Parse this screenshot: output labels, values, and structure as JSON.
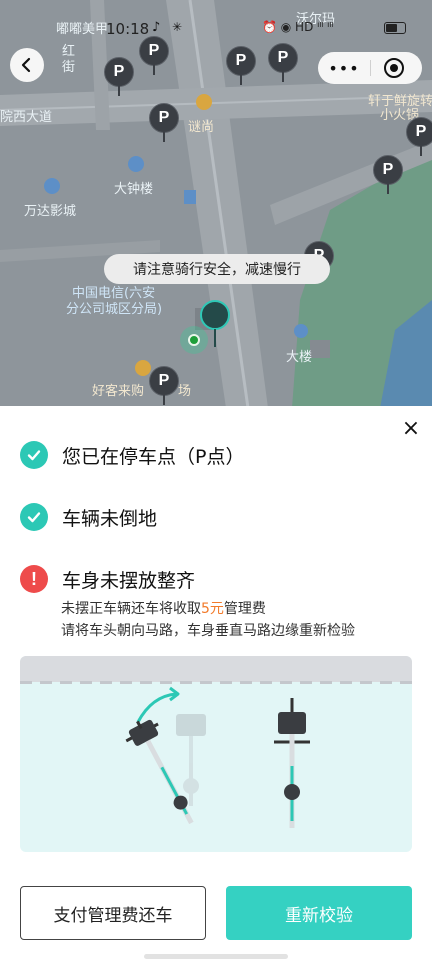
{
  "status_bar": {
    "time": "10:18",
    "icons_text": "⏰ ◉ HD ᴵˡˡ ᴵˡˡ"
  },
  "nav": {
    "more_label": "•••"
  },
  "map": {
    "labels": [
      "嘟嘟美甲",
      "沃尔玛",
      "红",
      "街",
      "院西大道",
      "谜尚",
      "轩于鲜旋转",
      "小火锅",
      "大钟楼",
      "万达影城",
      "中国电信(六安",
      "分公司城区分局)",
      "大楼",
      "好客来购",
      "场"
    ],
    "parking_marker_label": "P"
  },
  "toast": {
    "text": "请注意骑行安全，减速慢行"
  },
  "sheet": {
    "close_icon": "×",
    "checks": [
      {
        "status": "ok",
        "label": "您已在停车点（P点）"
      },
      {
        "status": "ok",
        "label": "车辆未倒地"
      },
      {
        "status": "error",
        "label": "车身未摆放整齐"
      }
    ],
    "error_icon_text": "!",
    "fee_line": {
      "prefix": "未摆正车辆还车将收取",
      "amount": "5元",
      "suffix": "管理费"
    },
    "instruction": "请将车头朝向马路，车身垂直马路边缘重新检验",
    "buttons": {
      "pay": "支付管理费还车",
      "recheck": "重新校验"
    }
  },
  "colors": {
    "accent": "#35d1c2",
    "check": "#2cc8b5",
    "error": "#ee4b4b",
    "fee": "#f27a2a"
  }
}
